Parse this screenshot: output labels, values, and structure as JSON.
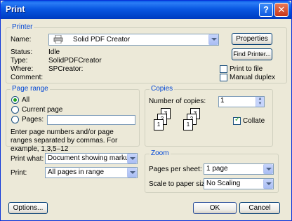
{
  "window": {
    "title": "Print",
    "help_button": "?",
    "close_button": "✕"
  },
  "printer": {
    "legend": "Printer",
    "name_label": "Name:",
    "name_value": "Solid PDF Creator",
    "status_label": "Status:",
    "status_value": "Idle",
    "type_label": "Type:",
    "type_value": "SolidPDFCreator",
    "where_label": "Where:",
    "where_value": "SPCreator:",
    "comment_label": "Comment:",
    "comment_value": "",
    "properties_button": "Properties",
    "find_printer_button": "Find Printer...",
    "print_to_file_label": "Print to file",
    "print_to_file_checked": false,
    "manual_duplex_label": "Manual duplex",
    "manual_duplex_checked": false
  },
  "page_range": {
    "legend": "Page range",
    "all_label": "All",
    "current_page_label": "Current page",
    "pages_label": "Pages:",
    "pages_value": "",
    "selected": "All",
    "hint": "Enter page numbers and/or page ranges separated by commas.  For example, 1,3,5–12"
  },
  "copies": {
    "legend": "Copies",
    "number_label": "Number of copies:",
    "number_value": "1",
    "collate_label": "Collate",
    "collate_checked": true,
    "stack1_pages": [
      "3",
      "2",
      "1"
    ],
    "stack2_pages": [
      "3",
      "2",
      "1"
    ]
  },
  "print_what": {
    "label": "Print what:",
    "value": "Document showing markup"
  },
  "print": {
    "label": "Print:",
    "value": "All pages in range"
  },
  "zoom": {
    "legend": "Zoom",
    "pages_per_sheet_label": "Pages per sheet:",
    "pages_per_sheet_value": "1 page",
    "scale_label": "Scale to paper size:",
    "scale_value": "No Scaling"
  },
  "footer": {
    "options_button": "Options...",
    "ok_button": "OK",
    "cancel_button": "Cancel"
  }
}
